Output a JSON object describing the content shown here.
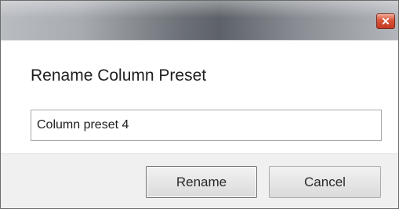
{
  "dialog": {
    "title": "Rename Column Preset",
    "input_value": "Column preset 4",
    "rename_label": "Rename",
    "cancel_label": "Cancel"
  },
  "icons": {
    "close": "close-icon"
  },
  "colors": {
    "close_button": "#d8543b",
    "footer_background": "#f0f0f0",
    "input_border": "#a9a9a9"
  }
}
